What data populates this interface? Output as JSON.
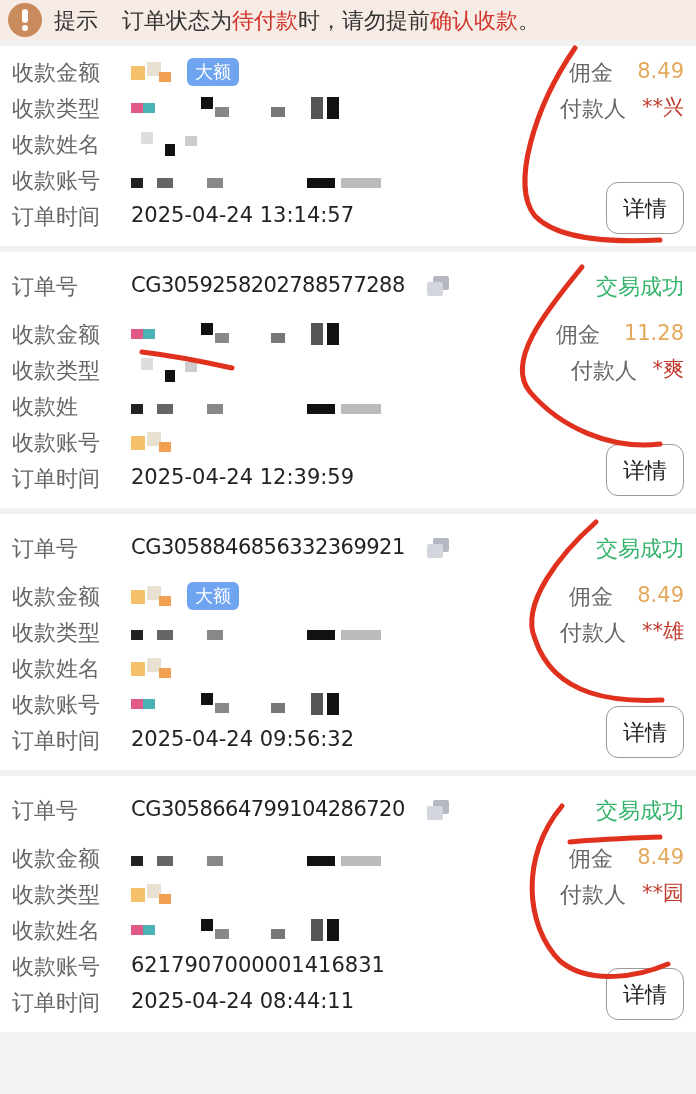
{
  "notice": {
    "label": "提示",
    "message": [
      {
        "text": "订单状态为",
        "highlight": false
      },
      {
        "text": "待付款",
        "highlight": true
      },
      {
        "text": "时，请勿提前",
        "highlight": false
      },
      {
        "text": "确认收款",
        "highlight": true
      },
      {
        "text": "。",
        "highlight": false
      }
    ]
  },
  "orders": [
    {
      "fields": [
        {
          "label": "收款金额",
          "large_tag": "大额"
        },
        {
          "label": "收款类型"
        },
        {
          "label": "收款姓名"
        },
        {
          "label": "收款账号"
        },
        {
          "label": "订单时间",
          "value": "2025-04-24 13:14:57"
        }
      ],
      "commission_label": "佣金",
      "commission": "8.49",
      "payer_label": "付款人",
      "payer": "**兴",
      "button": "详情"
    },
    {
      "order_label": "订单号",
      "order_no": "CG3059258202788577288",
      "status": "交易成功",
      "fields": [
        {
          "label": "收款金额"
        },
        {
          "label": "收款类型"
        },
        {
          "label": "收款姓"
        },
        {
          "label": "收款账号"
        },
        {
          "label": "订单时间",
          "value": "2025-04-24 12:39:59"
        }
      ],
      "commission_label": "佣金",
      "commission": "11.28",
      "payer_label": "付款人",
      "payer": "*爽",
      "button": "详情"
    },
    {
      "order_label": "订单号",
      "order_no": "CG3058846856332369921",
      "status": "交易成功",
      "fields": [
        {
          "label": "收款金额",
          "large_tag": "大额"
        },
        {
          "label": "收款类型"
        },
        {
          "label": "收款姓名"
        },
        {
          "label": "收款账号"
        },
        {
          "label": "订单时间",
          "value": "2025-04-24 09:56:32"
        }
      ],
      "commission_label": "佣金",
      "commission": "8.49",
      "payer_label": "付款人",
      "payer": "**雄",
      "button": "详情"
    },
    {
      "order_label": "订单号",
      "order_no": "CG3058664799104286720",
      "status": "交易成功",
      "fields": [
        {
          "label": "收款金额"
        },
        {
          "label": "收款类型"
        },
        {
          "label": "收款姓名"
        },
        {
          "label": "收款账号",
          "value": "6217907000001416831"
        },
        {
          "label": "订单时间",
          "value": "2025-04-24 08:44:11"
        }
      ],
      "commission_label": "佣金",
      "commission": "8.49",
      "payer_label": "付款人",
      "payer": "**园",
      "button": "详情"
    }
  ]
}
